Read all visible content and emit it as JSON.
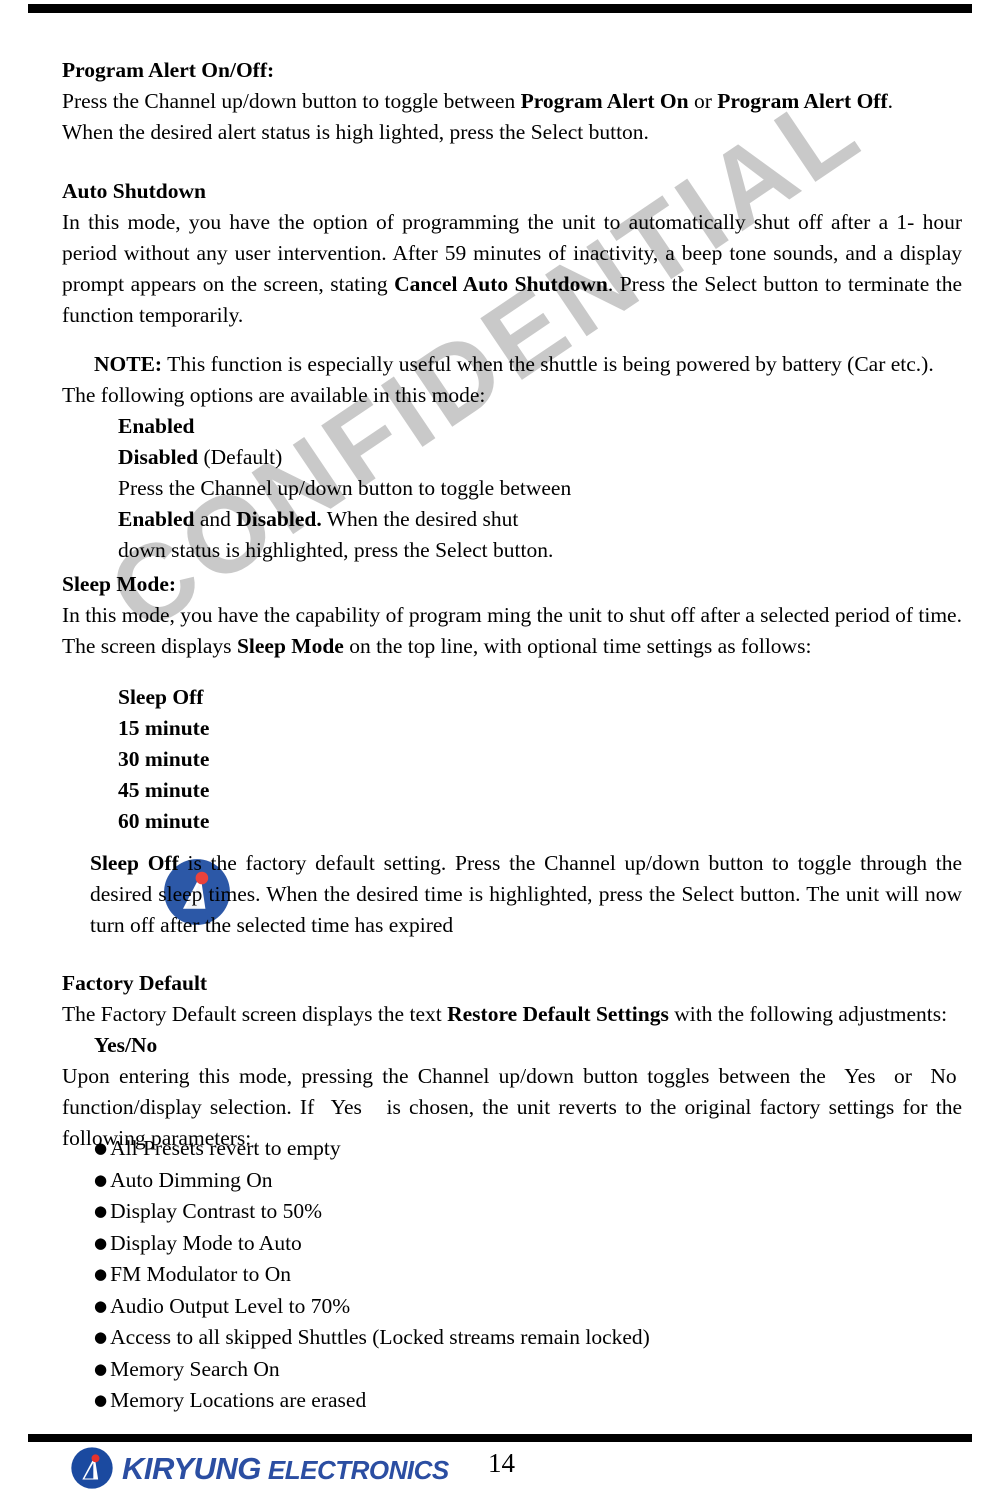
{
  "document": {
    "page_number": "14",
    "watermark": "CONFIDENTIAL",
    "watermark_color": "#c9c9c9"
  },
  "footer": {
    "brand_word1": "KIRYUNG",
    "brand_word2": "ELECTRONICS",
    "brand_color": "#2b4ea2",
    "logo_circle_color": "#1b4aa0",
    "logo_accent_color": "#e8322c"
  },
  "sections": {
    "program_alert": {
      "heading": "Program Alert On/Off:",
      "line1_a": "Press the Channel up/down button to toggle between ",
      "line1_b": "Program Alert On",
      "line1_c": " or ",
      "line1_d": "Program Alert Off",
      "line1_e": ".",
      "line2": "When the desired alert status is high lighted, press the Select button."
    },
    "auto_shutdown": {
      "heading": "Auto Shutdown",
      "para_a": "In this mode, you have the option of programming the unit to automatically shut off after a 1- hour period without any user intervention. After 59 minutes of inactivity, a beep tone sounds, and a display prompt appears on the screen, stating ",
      "para_b": "Cancel Auto Shutdown",
      "para_c": ". Press the Select button to terminate the function temporarily.",
      "note_label": "NOTE:",
      "note_text": " This function is especially useful when the shuttle is being powered by battery (Car etc.).",
      "options_intro": "The following options are available in this mode:",
      "option_enabled": "Enabled",
      "option_disabled": "Disabled",
      "option_disabled_suffix": " (Default)",
      "instr_line1": "Press the Channel up/down button to toggle between",
      "instr_line2_a": "Enabled",
      "instr_line2_b": " and ",
      "instr_line2_c": "Disabled.",
      "instr_line2_d": " When the desired shut",
      "instr_line3": "down status is highlighted, press the Select button."
    },
    "sleep_mode": {
      "heading": "Sleep Mode:",
      "para_line1": "In this mode, you have the capability of program ming the unit to shut off after a selected period of time.",
      "para_line2_a": "The screen displays ",
      "para_line2_b": "Sleep Mode",
      "para_line2_c": " on the top line, with optional time settings as follows:",
      "options": [
        "Sleep Off",
        "15 minute",
        "30 minute",
        "45 minute",
        "60 minute"
      ],
      "closing_a": "Sleep Off",
      "closing_b": " is the factory default setting. Press the Channel up/down button to toggle through the desired sleep times. When the desired time is highlighted, press the Select button. The unit will now turn off after the selected time has expired"
    },
    "factory_default": {
      "heading": "Factory Default",
      "intro_a": "The Factory Default screen displays the text ",
      "intro_b": "Restore Default Settings",
      "intro_c": " with the following adjustments:",
      "yes_no": "Yes/No",
      "para_a": "Upon entering this mode, pressing the Channel up/down button toggles between the ",
      "para_yes1": "Yes",
      "para_b": " or ",
      "para_no": "No",
      "para_c": " function/display selection. If ",
      "para_yes2": "Yes",
      "para_d": " is chosen, the unit reverts to the original factory settings for the following parameters:",
      "bullets": [
        "All Presets revert to empty",
        "Auto Dimming On",
        "Display Contrast to 50%",
        "Display Mode to Auto",
        "FM Modulator to On",
        "Audio Output Level to 70%",
        "Access to all skipped Shuttles (Locked streams remain locked)",
        "Memory Search On",
        "Memory Locations are erased"
      ]
    }
  }
}
